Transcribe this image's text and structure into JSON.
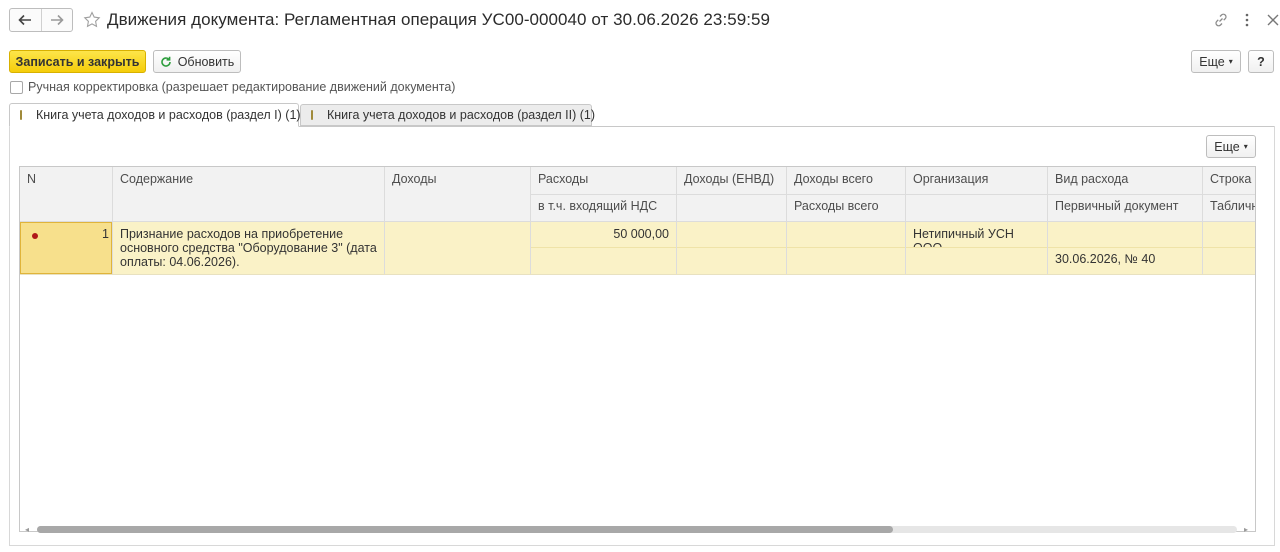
{
  "window": {
    "title": "Движения документа: Регламентная операция УС00-000040 от 30.06.2026 23:59:59",
    "icons": {
      "back": "arrow-left-icon",
      "forward": "arrow-right-icon",
      "favorite": "star-icon",
      "link": "link-icon",
      "more": "vertical-dots-icon",
      "close": "close-icon"
    }
  },
  "toolbar": {
    "save_close_label": "Записать и закрыть",
    "refresh_label": "Обновить",
    "more_label": "Еще",
    "help_label": "?"
  },
  "manual_edit": {
    "label": "Ручная корректировка (разрешает редактирование движений документа)",
    "checked": false
  },
  "tabs": [
    {
      "label": "Книга учета доходов и расходов (раздел I) (1)",
      "active": true
    },
    {
      "label": "Книга учета доходов и расходов (раздел II) (1)",
      "active": false
    }
  ],
  "table": {
    "more_label": "Еще",
    "columns": [
      {
        "top": "N",
        "bottom": ""
      },
      {
        "top": "Содержание",
        "bottom": ""
      },
      {
        "top": "Доходы",
        "bottom": ""
      },
      {
        "top": "Расходы",
        "bottom": "в т.ч. входящий НДС"
      },
      {
        "top": "Доходы (ЕНВД)",
        "bottom": ""
      },
      {
        "top": "Доходы всего",
        "bottom": "Расходы всего"
      },
      {
        "top": "Организация",
        "bottom": ""
      },
      {
        "top": "Вид расхода",
        "bottom": "Первичный документ"
      },
      {
        "top": "Строка д",
        "bottom": "Табличн"
      }
    ],
    "rows": [
      {
        "n": "1",
        "content": "Признание расходов на приобретение основного средства \"Оборудование 3\" (дата оплаты: 04.06.2026).",
        "income": "",
        "expenses": "50 000,00",
        "vat_incoming": "",
        "income_envd": "",
        "income_total": "",
        "expenses_total": "",
        "organization": "Нетипичный УСН ООО",
        "expense_type": "",
        "primary_document": "30.06.2026, № 40",
        "line_d": "",
        "tabular": ""
      }
    ]
  }
}
